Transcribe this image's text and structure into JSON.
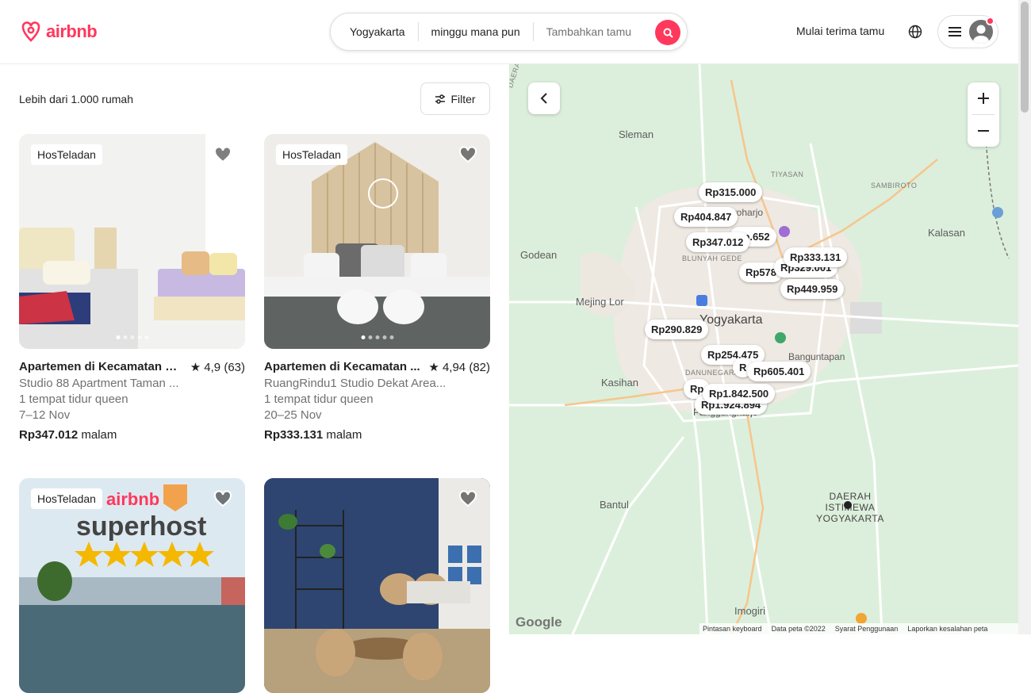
{
  "header": {
    "brand": "airbnb",
    "search": {
      "location": "Yogyakarta",
      "dates": "minggu mana pun",
      "guests": "Tambahkan tamu"
    },
    "host_link": "Mulai terima tamu",
    "icons": {
      "globe": "globe-icon",
      "menu": "menu-icon",
      "search": "search-icon",
      "avatar": "user-avatar-icon"
    },
    "colors": {
      "brand": "#ff385c"
    }
  },
  "listings": {
    "count_label": "Lebih dari 1.000 rumah",
    "filter_label": "Filter",
    "cards": [
      {
        "badge": "HosTeladan",
        "title": "Apartemen di Kecamatan M...",
        "rating": "★ 4,9 (63)",
        "subtitle": "Studio 88 Apartment Taman ...",
        "beds": "1 tempat tidur queen",
        "dates": "7–12 Nov",
        "price": "Rp347.012",
        "price_unit": "malam"
      },
      {
        "badge": "HosTeladan",
        "title": "Apartemen di Kecamatan ...",
        "rating": "★ 4,94 (82)",
        "subtitle": "RuangRindu1 Studio Dekat Area...",
        "beds": "1 tempat tidur queen",
        "dates": "20–25 Nov",
        "price": "Rp333.131",
        "price_unit": "malam"
      },
      {
        "badge": "HosTeladan",
        "overlay_brand": "airbnb",
        "overlay_text": "superhost"
      },
      {}
    ]
  },
  "map": {
    "labels": [
      "Sleman",
      "Godean",
      "Mejing Lor",
      "Kasihan",
      "Bantul",
      "Imogiri",
      "Kalasan",
      "Yogyakarta",
      "DAERAH ISTIMEWA YOGYAKARTA",
      "TIYASAN",
      "SAMBIROTO",
      "BLUNYAH GEDE",
      "DANUNEGARAN",
      "Panggungharjo",
      "Banguntapan",
      "Maguwoharjo",
      "DAERAH IST"
    ],
    "price_pins": [
      "Rp315.000",
      "Rp404.847",
      "Rp.652",
      "Rp347.012",
      "Rp333.131",
      "Rp578",
      "Rp329.001",
      "Rp449.959",
      "Rp290.829",
      "Rp254.475",
      "Rp605.401",
      "Rp1.842.500",
      "Rp1.924.894",
      "Rp",
      "R"
    ],
    "footer": [
      "Pintasan keyboard",
      "Data peta ©2022",
      "Syarat Penggunaan",
      "Laporkan kesalahan peta"
    ],
    "attribution": "Google"
  }
}
